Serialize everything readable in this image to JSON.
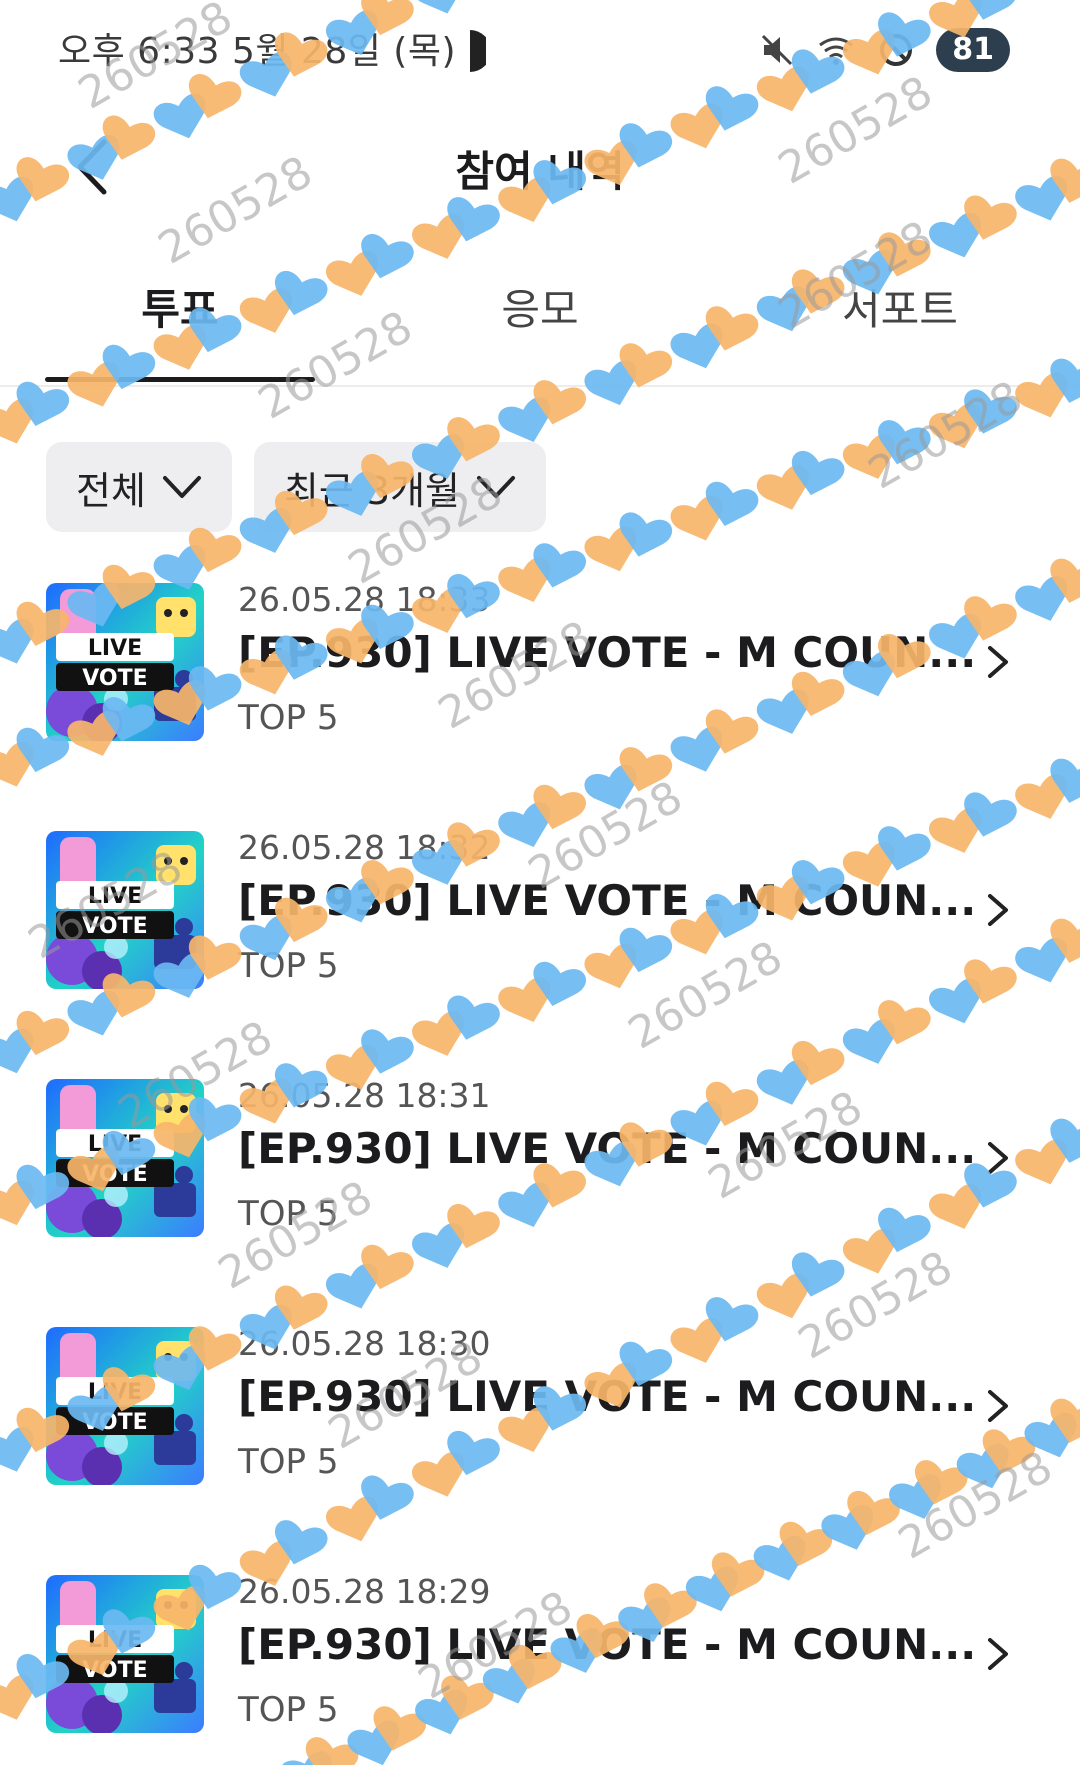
{
  "status_bar": {
    "time": "오후 6:33 5월 28일 (목)",
    "battery": "81",
    "icons": [
      "moon-icon",
      "mute-icon",
      "wifi-icon",
      "do-not-disturb-icon"
    ]
  },
  "header": {
    "title": "참여 내역",
    "back_icon": "chevron-left-icon"
  },
  "tabs": [
    {
      "label": "투표",
      "active": true
    },
    {
      "label": "응모",
      "active": false
    },
    {
      "label": "서포트",
      "active": false
    }
  ],
  "filters": {
    "category": "전체",
    "period": "최근 3개월"
  },
  "items": [
    {
      "date": "26.05.28 18:33",
      "title": "[EP.930] LIVE VOTE - M COUN...",
      "subtitle": "TOP 5"
    },
    {
      "date": "26.05.28 18:32",
      "title": "[EP.930] LIVE VOTE - M COUN...",
      "subtitle": "TOP 5"
    },
    {
      "date": "26.05.28 18:31",
      "title": "[EP.930] LIVE VOTE - M COUN...",
      "subtitle": "TOP 5"
    },
    {
      "date": "26.05.28 18:30",
      "title": "[EP.930] LIVE VOTE - M COUN...",
      "subtitle": "TOP 5"
    },
    {
      "date": "26.05.28 18:29",
      "title": "[EP.930] LIVE VOTE - M COUN...",
      "subtitle": "TOP 5"
    }
  ],
  "thumbnail": {
    "line1": "LIVE",
    "line2": "VOTE"
  },
  "watermark": {
    "text": "260528"
  },
  "colors": {
    "active_tab": "#1c1c1e",
    "chip_bg": "#eeeef1",
    "heart_blue": "#6bb8f2",
    "heart_orange": "#f7b56a"
  }
}
